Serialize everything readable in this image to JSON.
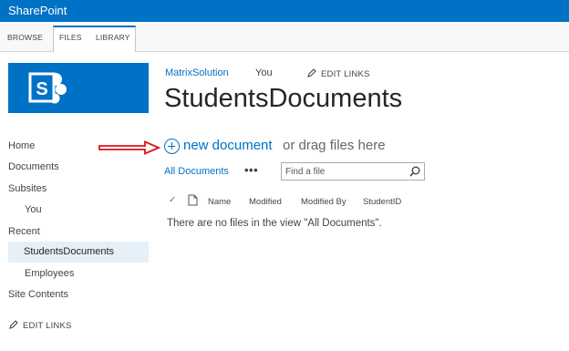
{
  "suite": {
    "brand": "SharePoint"
  },
  "ribbon": {
    "tabs": [
      "BROWSE",
      "FILES",
      "LIBRARY"
    ]
  },
  "header": {
    "site_link": "MatrixSolution",
    "you_link": "You",
    "edit_links": "EDIT LINKS",
    "page_title": "StudentsDocuments"
  },
  "nav": {
    "items": [
      "Home",
      "Documents",
      "Subsites",
      "You",
      "Recent",
      "StudentsDocuments",
      "Employees",
      "Site Contents"
    ],
    "edit_links": "EDIT LINKS"
  },
  "library": {
    "new_document": "new document",
    "drag_text": "or drag files here",
    "view_name": "All Documents",
    "more": "•••",
    "search_placeholder": "Find a file",
    "columns": [
      "Name",
      "Modified",
      "Modified By",
      "StudentID"
    ],
    "empty_message": "There are no files in the view \"All Documents\"."
  },
  "colors": {
    "brand_blue": "#0072c6",
    "annotation_red": "#d9141b",
    "selected_nav_bg": "#e6f0f8"
  },
  "icons": [
    "sharepoint-logo",
    "pencil-icon",
    "plus-circle-icon",
    "search-icon",
    "check-icon",
    "document-icon",
    "red-arrow-annotation"
  ]
}
